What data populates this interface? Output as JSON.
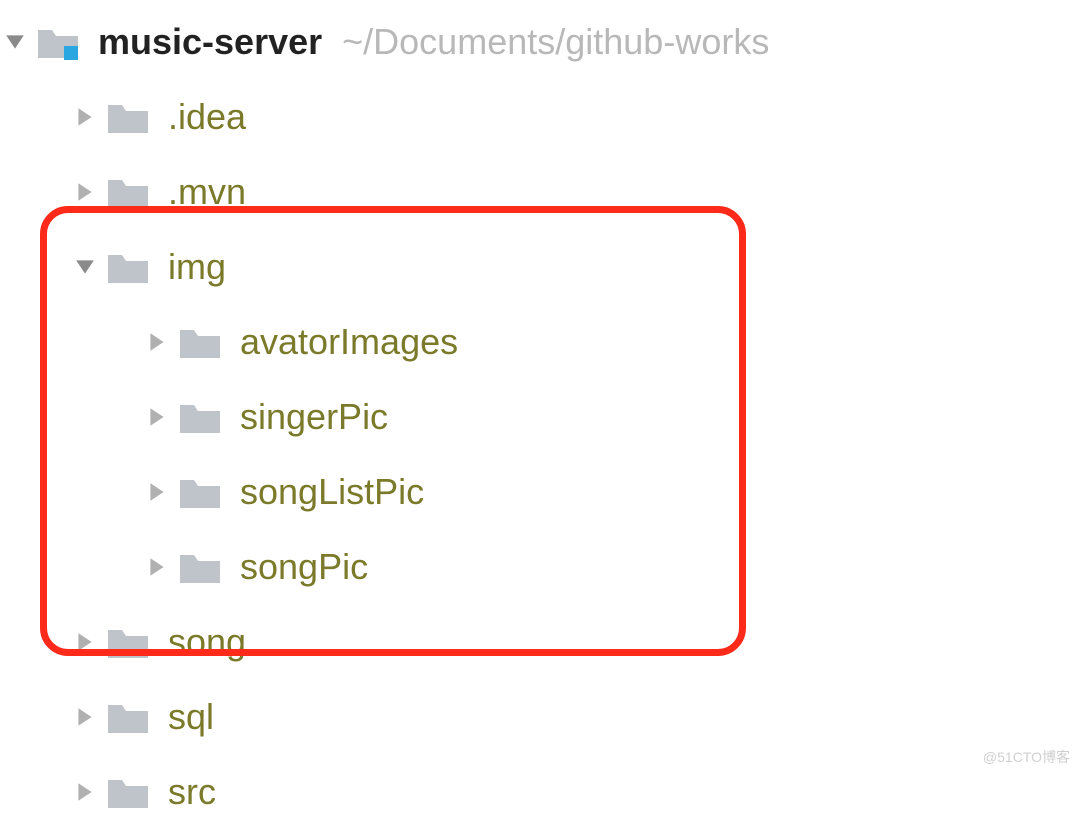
{
  "root": {
    "name": "music-server",
    "path": "~/Documents/github-works"
  },
  "nodes": {
    "idea": ".idea",
    "mvn": ".mvn",
    "img": "img",
    "avatorImages": "avatorImages",
    "singerPic": "singerPic",
    "songListPic": "songListPic",
    "songPic": "songPic",
    "song": "song",
    "sql": "sql",
    "src": "src"
  },
  "watermark": "@51CTO博客"
}
